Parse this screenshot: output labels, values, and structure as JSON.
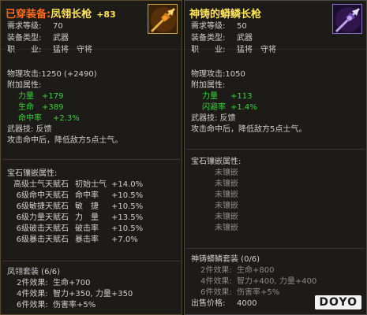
{
  "left": {
    "title_prefix": "已穿装备:",
    "title_name": "凤翎长枪",
    "title_plus": "+83",
    "level_label": "需求等级:",
    "level_value": "70",
    "type_label": "装备类型:",
    "type_value": "武器",
    "job_label": "职　　业:",
    "job_values": [
      "猛将",
      "守将"
    ],
    "phys_attack": "物理攻击:1250 (+2490)",
    "attr_header": "附加属性:",
    "attrs": [
      {
        "name": "力量",
        "value": "+179"
      },
      {
        "name": "生命",
        "value": "+389"
      },
      {
        "name": "命中率",
        "value": "+2.3%"
      }
    ],
    "skill": "武器技: 反馈",
    "skill_desc": "攻击命中后，降低敌方5点士气。",
    "gem_header": "宝石镶嵌属性:",
    "gems": [
      {
        "a": "高级士气天赋石",
        "b": "初始士气",
        "c": "+14.0%"
      },
      {
        "a": "6级命中天赋石",
        "b": "命中率",
        "c": "+10.5%"
      },
      {
        "a": "6级敏捷天赋石",
        "b": "敏　捷",
        "c": "+10.5%"
      },
      {
        "a": "6级力量天赋石",
        "b": "力　量",
        "c": "+13.5%"
      },
      {
        "a": "6级破击天赋石",
        "b": "破击率",
        "c": "+10.5%"
      },
      {
        "a": "6级暴击天赋石",
        "b": "暴击率",
        "c": "+7.0%"
      }
    ],
    "set_header": "凤翎套装 (6/6)",
    "set_effects": [
      {
        "label": "2件效果:",
        "text": "生命+700"
      },
      {
        "label": "4件效果:",
        "text": "智力+350, 力量+350"
      },
      {
        "label": "6件效果:",
        "text": "伤害率+5%"
      }
    ]
  },
  "right": {
    "title_name": "神铸的蟒鳞长枪",
    "level_label": "需求等级:",
    "level_value": "50",
    "type_label": "装备类型:",
    "type_value": "武器",
    "job_label": "职　　业:",
    "job_values": [
      "猛将",
      "守将"
    ],
    "phys_attack": "物理攻击:1050",
    "attr_header": "附加属性:",
    "attrs": [
      {
        "name": "力量",
        "value": "+113"
      },
      {
        "name": "闪避率",
        "value": "+1.4%"
      }
    ],
    "skill": "武器技: 反馈",
    "skill_desc": "攻击命中后，降低敌方5点士气。",
    "gem_header": "宝石镶嵌属性:",
    "gems": [
      "未镶嵌",
      "未镶嵌",
      "未镶嵌",
      "未镶嵌",
      "未镶嵌",
      "未镶嵌"
    ],
    "set_header": "神铸蟒鳞套装 (0/6)",
    "set_effects": [
      {
        "label": "2件效果:",
        "text": "生命+800"
      },
      {
        "label": "4件效果:",
        "text": "智力+400, 力量+400"
      },
      {
        "label": "6件效果:",
        "text": "伤害率+5%"
      }
    ],
    "price_label": "出售价格:",
    "price_value": "4000"
  },
  "watermark": "DOYO",
  "colors": {
    "worn": "#ff6a1a",
    "item_name": "#ffe45a",
    "stat_green": "#39d23a",
    "inactive_gray": "#8a8a8a"
  },
  "icons": {
    "left_item": "spear-icon",
    "right_item": "spear-icon"
  }
}
